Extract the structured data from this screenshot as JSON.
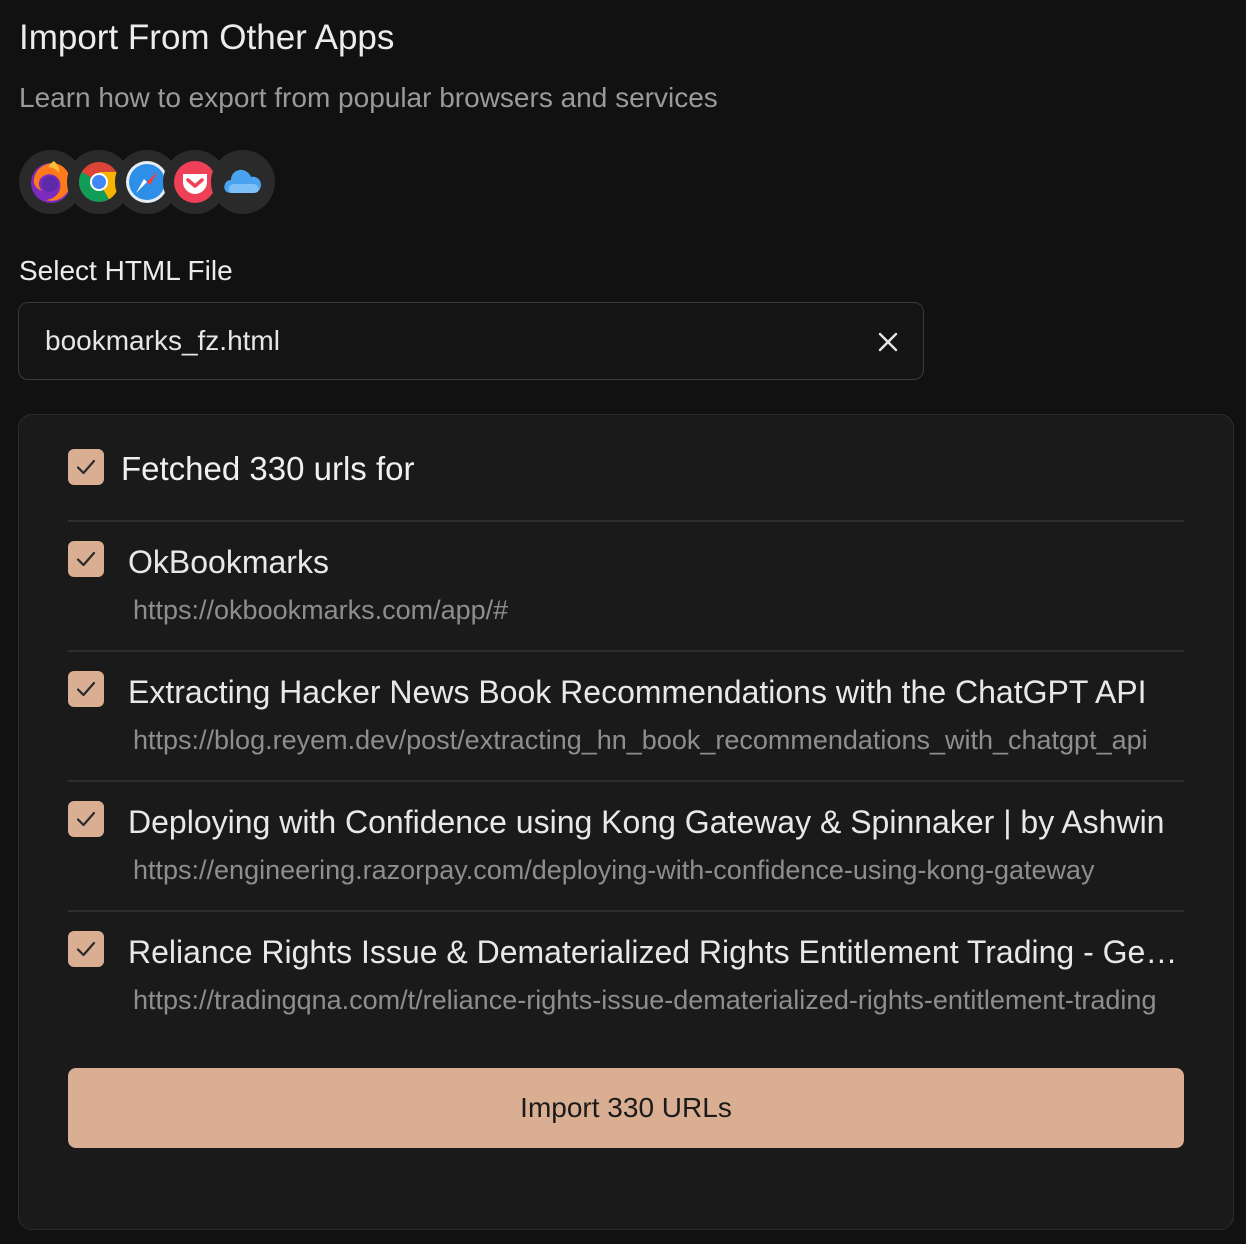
{
  "header": {
    "title": "Import From Other Apps",
    "subtitle": "Learn how to export from popular browsers and services"
  },
  "apps": [
    {
      "icon": "firefox-icon"
    },
    {
      "icon": "chrome-icon"
    },
    {
      "icon": "safari-icon"
    },
    {
      "icon": "pocket-icon"
    },
    {
      "icon": "icloud-icon"
    }
  ],
  "file_select": {
    "label": "Select HTML File",
    "value": "bookmarks_fz.html",
    "clear_icon": "close-icon"
  },
  "results": {
    "header": "Fetched 330 urls for",
    "header_checked": true,
    "items": [
      {
        "checked": true,
        "title": "OkBookmarks",
        "url": "https://okbookmarks.com/app/#"
      },
      {
        "checked": true,
        "title": "Extracting Hacker News Book Recommendations with the ChatGPT API",
        "url": "https://blog.reyem.dev/post/extracting_hn_book_recommendations_with_chatgpt_api"
      },
      {
        "checked": true,
        "title": "Deploying with Confidence using Kong Gateway & Spinnaker | by Ashwin",
        "url": "https://engineering.razorpay.com/deploying-with-confidence-using-kong-gateway"
      },
      {
        "checked": true,
        "title": "Reliance Rights Issue & Dematerialized Rights Entitlement Trading - General",
        "url": "https://tradingqna.com/t/reliance-rights-issue-dematerialized-rights-entitlement-trading"
      }
    ],
    "import_button": "Import 330 URLs"
  },
  "colors": {
    "accent": "#d9ae92",
    "background": "#111111",
    "panel": "#1a1a1a"
  }
}
